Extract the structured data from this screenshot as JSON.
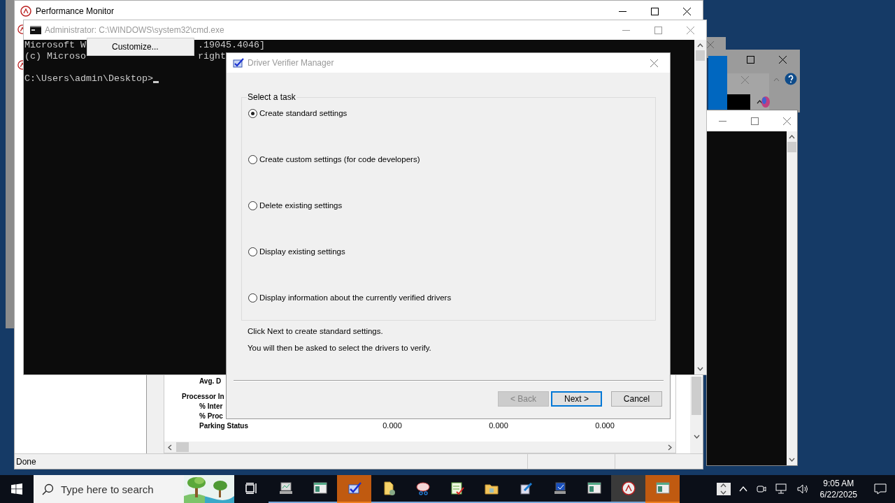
{
  "perfmon": {
    "title": "Performance Monitor",
    "report_rows": [
      {
        "label": "Avg. D",
        "kind": "counter"
      },
      {
        "label": "Processor In",
        "kind": "object"
      },
      {
        "label": "% Inter",
        "kind": "counter"
      },
      {
        "label": "% Proc",
        "kind": "counter"
      },
      {
        "label": "Parking Status",
        "kind": "counter",
        "values": [
          "0.000",
          "0.000",
          "0.000"
        ]
      }
    ],
    "status": "Done"
  },
  "cmd": {
    "title": "Administrator: C:\\WINDOWS\\system32\\cmd.exe",
    "lines": [
      {
        "text": "Microsoft W",
        "tail": ".19045.4046]"
      },
      {
        "text": "(c) Microso",
        "tail": "right"
      }
    ],
    "prompt": "C:\\Users\\admin\\Desktop>",
    "cursor": true
  },
  "context_menu": {
    "items": [
      "Customize..."
    ]
  },
  "dialog": {
    "title": "Driver Verifier Manager",
    "group_label": "Select a task",
    "options": [
      {
        "label": "Create standard settings",
        "selected": true
      },
      {
        "label": "Create custom settings (for code developers)",
        "selected": false
      },
      {
        "label": "Delete existing settings",
        "selected": false
      },
      {
        "label": "Display existing settings",
        "selected": false
      },
      {
        "label": "Display information about the currently verified drivers",
        "selected": false
      }
    ],
    "hint": "Click Next to create standard settings.",
    "note": "You will then be asked to select the drivers to verify.",
    "buttons": [
      {
        "label": "< Back",
        "disabled": true,
        "default": false
      },
      {
        "label": "Next >",
        "disabled": false,
        "default": true
      },
      {
        "label": "Cancel",
        "disabled": false,
        "default": false
      }
    ]
  },
  "taskbar": {
    "search_placeholder": "Type here to search",
    "apps": [
      {
        "kind": "monitor",
        "flashing": false,
        "active": false
      },
      {
        "kind": "window",
        "flashing": false,
        "active": false
      },
      {
        "kind": "verifier",
        "flashing": true,
        "active": false
      },
      {
        "kind": "file",
        "flashing": false,
        "active": false
      },
      {
        "kind": "snip",
        "flashing": false,
        "active": false
      },
      {
        "kind": "checklist",
        "flashing": false,
        "active": false
      },
      {
        "kind": "folder",
        "flashing": false,
        "active": false
      },
      {
        "kind": "pen",
        "flashing": false,
        "active": false
      },
      {
        "kind": "network",
        "flashing": false,
        "active": false
      },
      {
        "kind": "window",
        "flashing": false,
        "active": false
      },
      {
        "kind": "gauge",
        "flashing": false,
        "active": true
      },
      {
        "kind": "window",
        "flashing": true,
        "active": false
      }
    ],
    "time": "9:05 AM",
    "date": "6/22/2025"
  }
}
